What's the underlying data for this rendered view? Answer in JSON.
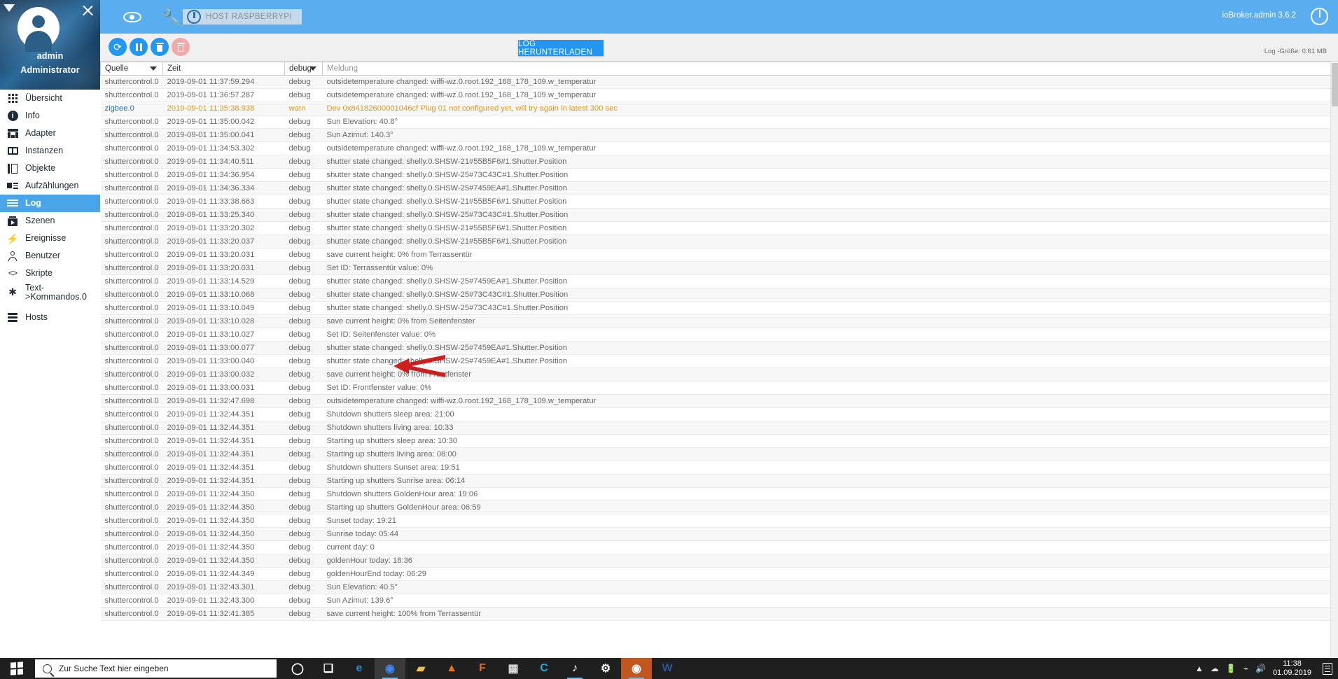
{
  "sidebar": {
    "user": "admin",
    "role": "Administrator",
    "collapse_icon": "caret-down-icon",
    "close_icon": "close-icon",
    "items": [
      {
        "label": "Übersicht",
        "icon": "grid-icon",
        "active": false
      },
      {
        "label": "Info",
        "icon": "info-icon",
        "active": false
      },
      {
        "label": "Adapter",
        "icon": "adapter-icon",
        "active": false
      },
      {
        "label": "Instanzen",
        "icon": "instances-icon",
        "active": false
      },
      {
        "label": "Objekte",
        "icon": "objects-icon",
        "active": false
      },
      {
        "label": "Aufzählungen",
        "icon": "enumerations-icon",
        "active": false
      },
      {
        "label": "Log",
        "icon": "log-icon",
        "active": true
      },
      {
        "label": "Szenen",
        "icon": "scenes-icon",
        "active": false
      },
      {
        "label": "Ereignisse",
        "icon": "events-bolt-icon",
        "active": false
      },
      {
        "label": "Benutzer",
        "icon": "user-icon",
        "active": false
      },
      {
        "label": "Skripte",
        "icon": "code-icon",
        "active": false
      },
      {
        "label": "Text->Kommandos.0",
        "icon": "asterisk-icon",
        "active": false
      },
      {
        "label": "Hosts",
        "icon": "hosts-icon",
        "active": false
      }
    ]
  },
  "topbar": {
    "eye_icon": "eye-icon",
    "wrench_icon": "wrench-icon",
    "host_chip_label": "HOST RASPBERRYPI",
    "host_chip_icon": "power-info-icon",
    "version": "ioBroker.admin 3.6.2",
    "power_icon": "power-icon",
    "accent_color": "#5aaef0"
  },
  "logbar": {
    "refresh_label": "⟳",
    "refresh_icon": "refresh-icon",
    "pause_icon": "pause-icon",
    "trash_icon": "trash-icon",
    "delete_icon": "trash-x-icon",
    "download_label": "LOG HERUNTERLADEN",
    "log_size": "Log -Größe: 0.61 MB"
  },
  "table": {
    "columns": [
      {
        "label": "Quelle",
        "filter": true
      },
      {
        "label": "Zeit",
        "filter": false
      },
      {
        "label": "debug",
        "filter": true
      },
      {
        "label": "Meldung",
        "filter": false
      }
    ],
    "rows": [
      [
        "shuttercontrol.0",
        "2019-09-01 11:37:59.294",
        "debug",
        "outsidetemperature changed: wiffi-wz.0.root.192_168_178_109.w_temperatur",
        "debug"
      ],
      [
        "shuttercontrol.0",
        "2019-09-01 11:36:57.287",
        "debug",
        "outsidetemperature changed: wiffi-wz.0.root.192_168_178_109.w_temperatur",
        "debug"
      ],
      [
        "zigbee.0",
        "2019-09-01 11:35:38.938",
        "warn",
        "Dev 0x84182600001046cf Plug 01 not configured yet, will try again in latest 300 sec",
        "warn"
      ],
      [
        "shuttercontrol.0",
        "2019-09-01 11:35:00.042",
        "debug",
        "Sun Elevation: 40.8°",
        "debug"
      ],
      [
        "shuttercontrol.0",
        "2019-09-01 11:35:00.041",
        "debug",
        "Sun Azimut: 140.3°",
        "debug"
      ],
      [
        "shuttercontrol.0",
        "2019-09-01 11:34:53.302",
        "debug",
        "outsidetemperature changed: wiffi-wz.0.root.192_168_178_109.w_temperatur",
        "debug"
      ],
      [
        "shuttercontrol.0",
        "2019-09-01 11:34:40.511",
        "debug",
        "shutter state changed: shelly.0.SHSW-21#55B5F6#1.Shutter.Position",
        "debug"
      ],
      [
        "shuttercontrol.0",
        "2019-09-01 11:34:36.954",
        "debug",
        "shutter state changed: shelly.0.SHSW-25#73C43C#1.Shutter.Position",
        "debug"
      ],
      [
        "shuttercontrol.0",
        "2019-09-01 11:34:36.334",
        "debug",
        "shutter state changed: shelly.0.SHSW-25#7459EA#1.Shutter.Position",
        "debug"
      ],
      [
        "shuttercontrol.0",
        "2019-09-01 11:33:38.663",
        "debug",
        "shutter state changed: shelly.0.SHSW-21#55B5F6#1.Shutter.Position",
        "debug"
      ],
      [
        "shuttercontrol.0",
        "2019-09-01 11:33:25.340",
        "debug",
        "shutter state changed: shelly.0.SHSW-25#73C43C#1.Shutter.Position",
        "debug"
      ],
      [
        "shuttercontrol.0",
        "2019-09-01 11:33:20.302",
        "debug",
        "shutter state changed: shelly.0.SHSW-21#55B5F6#1.Shutter.Position",
        "debug"
      ],
      [
        "shuttercontrol.0",
        "2019-09-01 11:33:20.037",
        "debug",
        "shutter state changed: shelly.0.SHSW-21#55B5F6#1.Shutter.Position",
        "debug"
      ],
      [
        "shuttercontrol.0",
        "2019-09-01 11:33:20.031",
        "debug",
        "save current height: 0% from Terrassentür",
        "debug"
      ],
      [
        "shuttercontrol.0",
        "2019-09-01 11:33:20.031",
        "debug",
        "Set ID: Terrassentür value: 0%",
        "debug"
      ],
      [
        "shuttercontrol.0",
        "2019-09-01 11:33:14.529",
        "debug",
        "shutter state changed: shelly.0.SHSW-25#7459EA#1.Shutter.Position",
        "debug"
      ],
      [
        "shuttercontrol.0",
        "2019-09-01 11:33:10.068",
        "debug",
        "shutter state changed: shelly.0.SHSW-25#73C43C#1.Shutter.Position",
        "debug"
      ],
      [
        "shuttercontrol.0",
        "2019-09-01 11:33:10.049",
        "debug",
        "shutter state changed: shelly.0.SHSW-25#73C43C#1.Shutter.Position",
        "debug"
      ],
      [
        "shuttercontrol.0",
        "2019-09-01 11:33:10.028",
        "debug",
        "save current height: 0% from Seitenfenster",
        "debug"
      ],
      [
        "shuttercontrol.0",
        "2019-09-01 11:33:10.027",
        "debug",
        "Set ID: Seitenfenster value: 0%",
        "debug"
      ],
      [
        "shuttercontrol.0",
        "2019-09-01 11:33:00.077",
        "debug",
        "shutter state changed: shelly.0.SHSW-25#7459EA#1.Shutter.Position",
        "debug"
      ],
      [
        "shuttercontrol.0",
        "2019-09-01 11:33:00.040",
        "debug",
        "shutter state changed: shelly.0.SHSW-25#7459EA#1.Shutter.Position",
        "debug"
      ],
      [
        "shuttercontrol.0",
        "2019-09-01 11:33:00.032",
        "debug",
        "save current height: 0% from Frontfenster",
        "debug"
      ],
      [
        "shuttercontrol.0",
        "2019-09-01 11:33:00.031",
        "debug",
        "Set ID: Frontfenster value: 0%",
        "debug"
      ],
      [
        "shuttercontrol.0",
        "2019-09-01 11:32:47.698",
        "debug",
        "outsidetemperature changed: wiffi-wz.0.root.192_168_178_109.w_temperatur",
        "debug"
      ],
      [
        "shuttercontrol.0",
        "2019-09-01 11:32:44.351",
        "debug",
        "Shutdown shutters sleep area: 21:00",
        "debug"
      ],
      [
        "shuttercontrol.0",
        "2019-09-01 11:32:44.351",
        "debug",
        "Shutdown shutters living area: 10:33",
        "debug"
      ],
      [
        "shuttercontrol.0",
        "2019-09-01 11:32:44.351",
        "debug",
        "Starting up shutters sleep area: 10:30",
        "debug"
      ],
      [
        "shuttercontrol.0",
        "2019-09-01 11:32:44.351",
        "debug",
        "Starting up shutters living area: 08:00",
        "debug"
      ],
      [
        "shuttercontrol.0",
        "2019-09-01 11:32:44.351",
        "debug",
        "Shutdown shutters Sunset area: 19:51",
        "debug"
      ],
      [
        "shuttercontrol.0",
        "2019-09-01 11:32:44.351",
        "debug",
        "Starting up shutters Sunrise area: 06:14",
        "debug"
      ],
      [
        "shuttercontrol.0",
        "2019-09-01 11:32:44.350",
        "debug",
        "Shutdown shutters GoldenHour area: 19:06",
        "debug"
      ],
      [
        "shuttercontrol.0",
        "2019-09-01 11:32:44.350",
        "debug",
        "Starting up shutters GoldenHour area: 06:59",
        "debug"
      ],
      [
        "shuttercontrol.0",
        "2019-09-01 11:32:44.350",
        "debug",
        "Sunset today: 19:21",
        "debug"
      ],
      [
        "shuttercontrol.0",
        "2019-09-01 11:32:44.350",
        "debug",
        "Sunrise today: 05:44",
        "debug"
      ],
      [
        "shuttercontrol.0",
        "2019-09-01 11:32:44.350",
        "debug",
        "current day: 0",
        "debug"
      ],
      [
        "shuttercontrol.0",
        "2019-09-01 11:32:44.350",
        "debug",
        "goldenHour today: 18:36",
        "debug"
      ],
      [
        "shuttercontrol.0",
        "2019-09-01 11:32:44.349",
        "debug",
        "goldenHourEnd today: 06:29",
        "debug"
      ],
      [
        "shuttercontrol.0",
        "2019-09-01 11:32:43.301",
        "debug",
        "Sun Elevation: 40.5°",
        "debug"
      ],
      [
        "shuttercontrol.0",
        "2019-09-01 11:32:43.300",
        "debug",
        "Sun Azimut: 139.6°",
        "debug"
      ],
      [
        "shuttercontrol.0",
        "2019-09-01 11:32:41.385",
        "debug",
        "save current height: 100% from Terrassentür",
        "debug"
      ]
    ]
  },
  "annotation": {
    "type": "red-arrow",
    "points_to_row_message": "Shutdown shutters living area: 10:33",
    "color": "#cc1f1f"
  },
  "taskbar": {
    "start_icon": "windows-start-icon",
    "search_placeholder": "Zur Suche Text hier eingeben",
    "search_icon": "search-icon",
    "apps": [
      {
        "name": "cortana-icon",
        "glyph": "◯",
        "color": "#ffffff",
        "bg": ""
      },
      {
        "name": "task-view-icon",
        "glyph": "❏",
        "color": "#ffffff",
        "bg": ""
      },
      {
        "name": "microsoft-edge-icon",
        "glyph": "e",
        "color": "#2a8fd4",
        "bg": ""
      },
      {
        "name": "google-chrome-icon",
        "glyph": "◉",
        "color": "#4285f4",
        "bg": "#3b3b3b"
      },
      {
        "name": "file-explorer-icon",
        "glyph": "▰",
        "color": "#f4c04a",
        "bg": ""
      },
      {
        "name": "vlc-media-player-icon",
        "glyph": "▲",
        "color": "#e8780c",
        "bg": ""
      },
      {
        "name": "foxit-reader-icon",
        "glyph": "F",
        "color": "#e26a1f",
        "bg": ""
      },
      {
        "name": "calculator-icon",
        "glyph": "▦",
        "color": "#dcdcdc",
        "bg": ""
      },
      {
        "name": "c-app-icon",
        "glyph": "C",
        "color": "#2aa7dd",
        "bg": ""
      },
      {
        "name": "amazon-music-icon",
        "glyph": "♪",
        "color": "#ffffff",
        "bg": "#3b1f8f"
      },
      {
        "name": "settings-gear-icon",
        "glyph": "⚙",
        "color": "#ffffff",
        "bg": ""
      },
      {
        "name": "avira-icon",
        "glyph": "◉",
        "color": "#ffffff",
        "bg": "#c1561e"
      },
      {
        "name": "microsoft-word-icon",
        "glyph": "W",
        "color": "#2b579a",
        "bg": ""
      }
    ],
    "tray": {
      "chevron": "▲",
      "cloud_icon": "onedrive-cloud-icon",
      "battery_icon": "battery-icon",
      "network_icon": "wifi-icon",
      "volume_icon": "speaker-icon",
      "time": "11:38",
      "date": "01.09.2019",
      "notification_icon": "action-center-icon"
    }
  }
}
